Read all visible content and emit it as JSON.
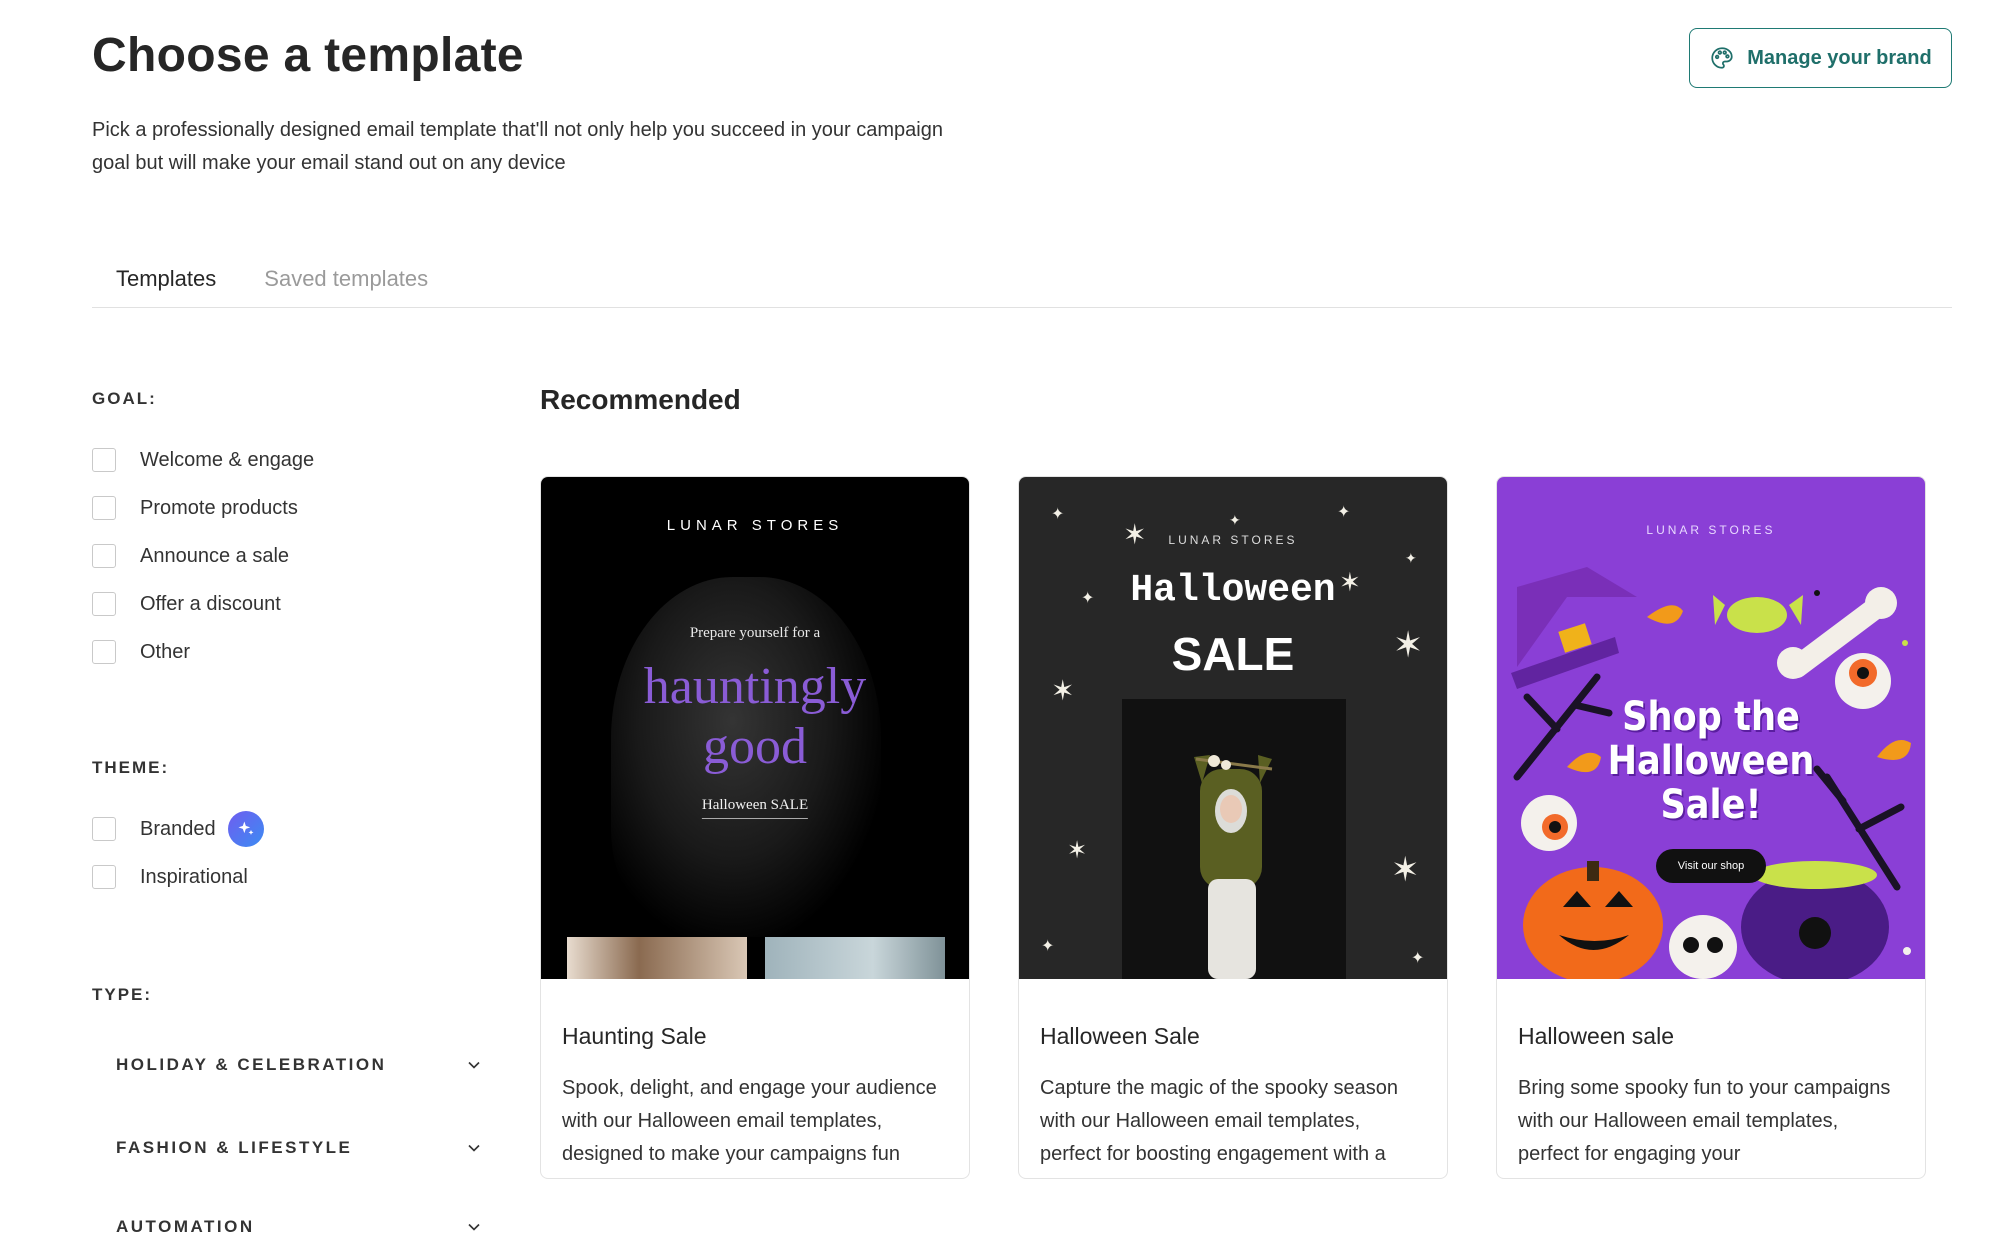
{
  "header": {
    "title": "Choose a template",
    "subtitle": "Pick a professionally designed email template that'll not only help you succeed in your campaign goal but will make your email stand out on any device",
    "manage_brand_label": "Manage your brand"
  },
  "tabs": [
    {
      "label": "Templates",
      "active": true
    },
    {
      "label": "Saved templates",
      "active": false
    }
  ],
  "filters": {
    "goal": {
      "heading": "GOAL:",
      "options": [
        "Welcome & engage",
        "Promote products",
        "Announce a sale",
        "Offer a discount",
        "Other"
      ]
    },
    "theme": {
      "heading": "THEME:",
      "options": [
        "Branded",
        "Inspirational"
      ]
    },
    "type": {
      "heading": "TYPE:",
      "groups": [
        "HOLIDAY & CELEBRATION",
        "FASHION & LIFESTYLE",
        "AUTOMATION"
      ]
    }
  },
  "main": {
    "section_title": "Recommended",
    "cards": [
      {
        "title": "Haunting Sale",
        "description": "Spook, delight, and engage your audience with our Halloween email templates, designed to make your campaigns fun",
        "image": {
          "store": "LUNAR STORES",
          "pre": "Prepare yourself for a",
          "line1": "hauntingly",
          "line2": "good",
          "link": "Halloween SALE"
        }
      },
      {
        "title": "Halloween Sale",
        "description": "Capture the magic of the spooky season with our Halloween email templates, perfect for boosting engagement with a",
        "image": {
          "store": "LUNAR STORES",
          "line1": "Halloween",
          "line2": "SALE"
        }
      },
      {
        "title": "Halloween sale",
        "description": "Bring some spooky fun to your campaigns with our Halloween email templates, perfect for engaging your",
        "image": {
          "store": "LUNAR STORES",
          "headline_1": "Shop the",
          "headline_2": "Halloween",
          "headline_3": "Sale!",
          "button": "Visit our shop"
        }
      }
    ]
  },
  "colors": {
    "accent": "#1f7a74",
    "purple_text": "#8a5cd6",
    "card3_bg": "#8a3fd6",
    "card2_bg": "#272727"
  },
  "icons": {
    "brand_button": "palette-icon",
    "branded_badge": "sparkle-icon",
    "type_expand": "chevron-down-icon"
  }
}
